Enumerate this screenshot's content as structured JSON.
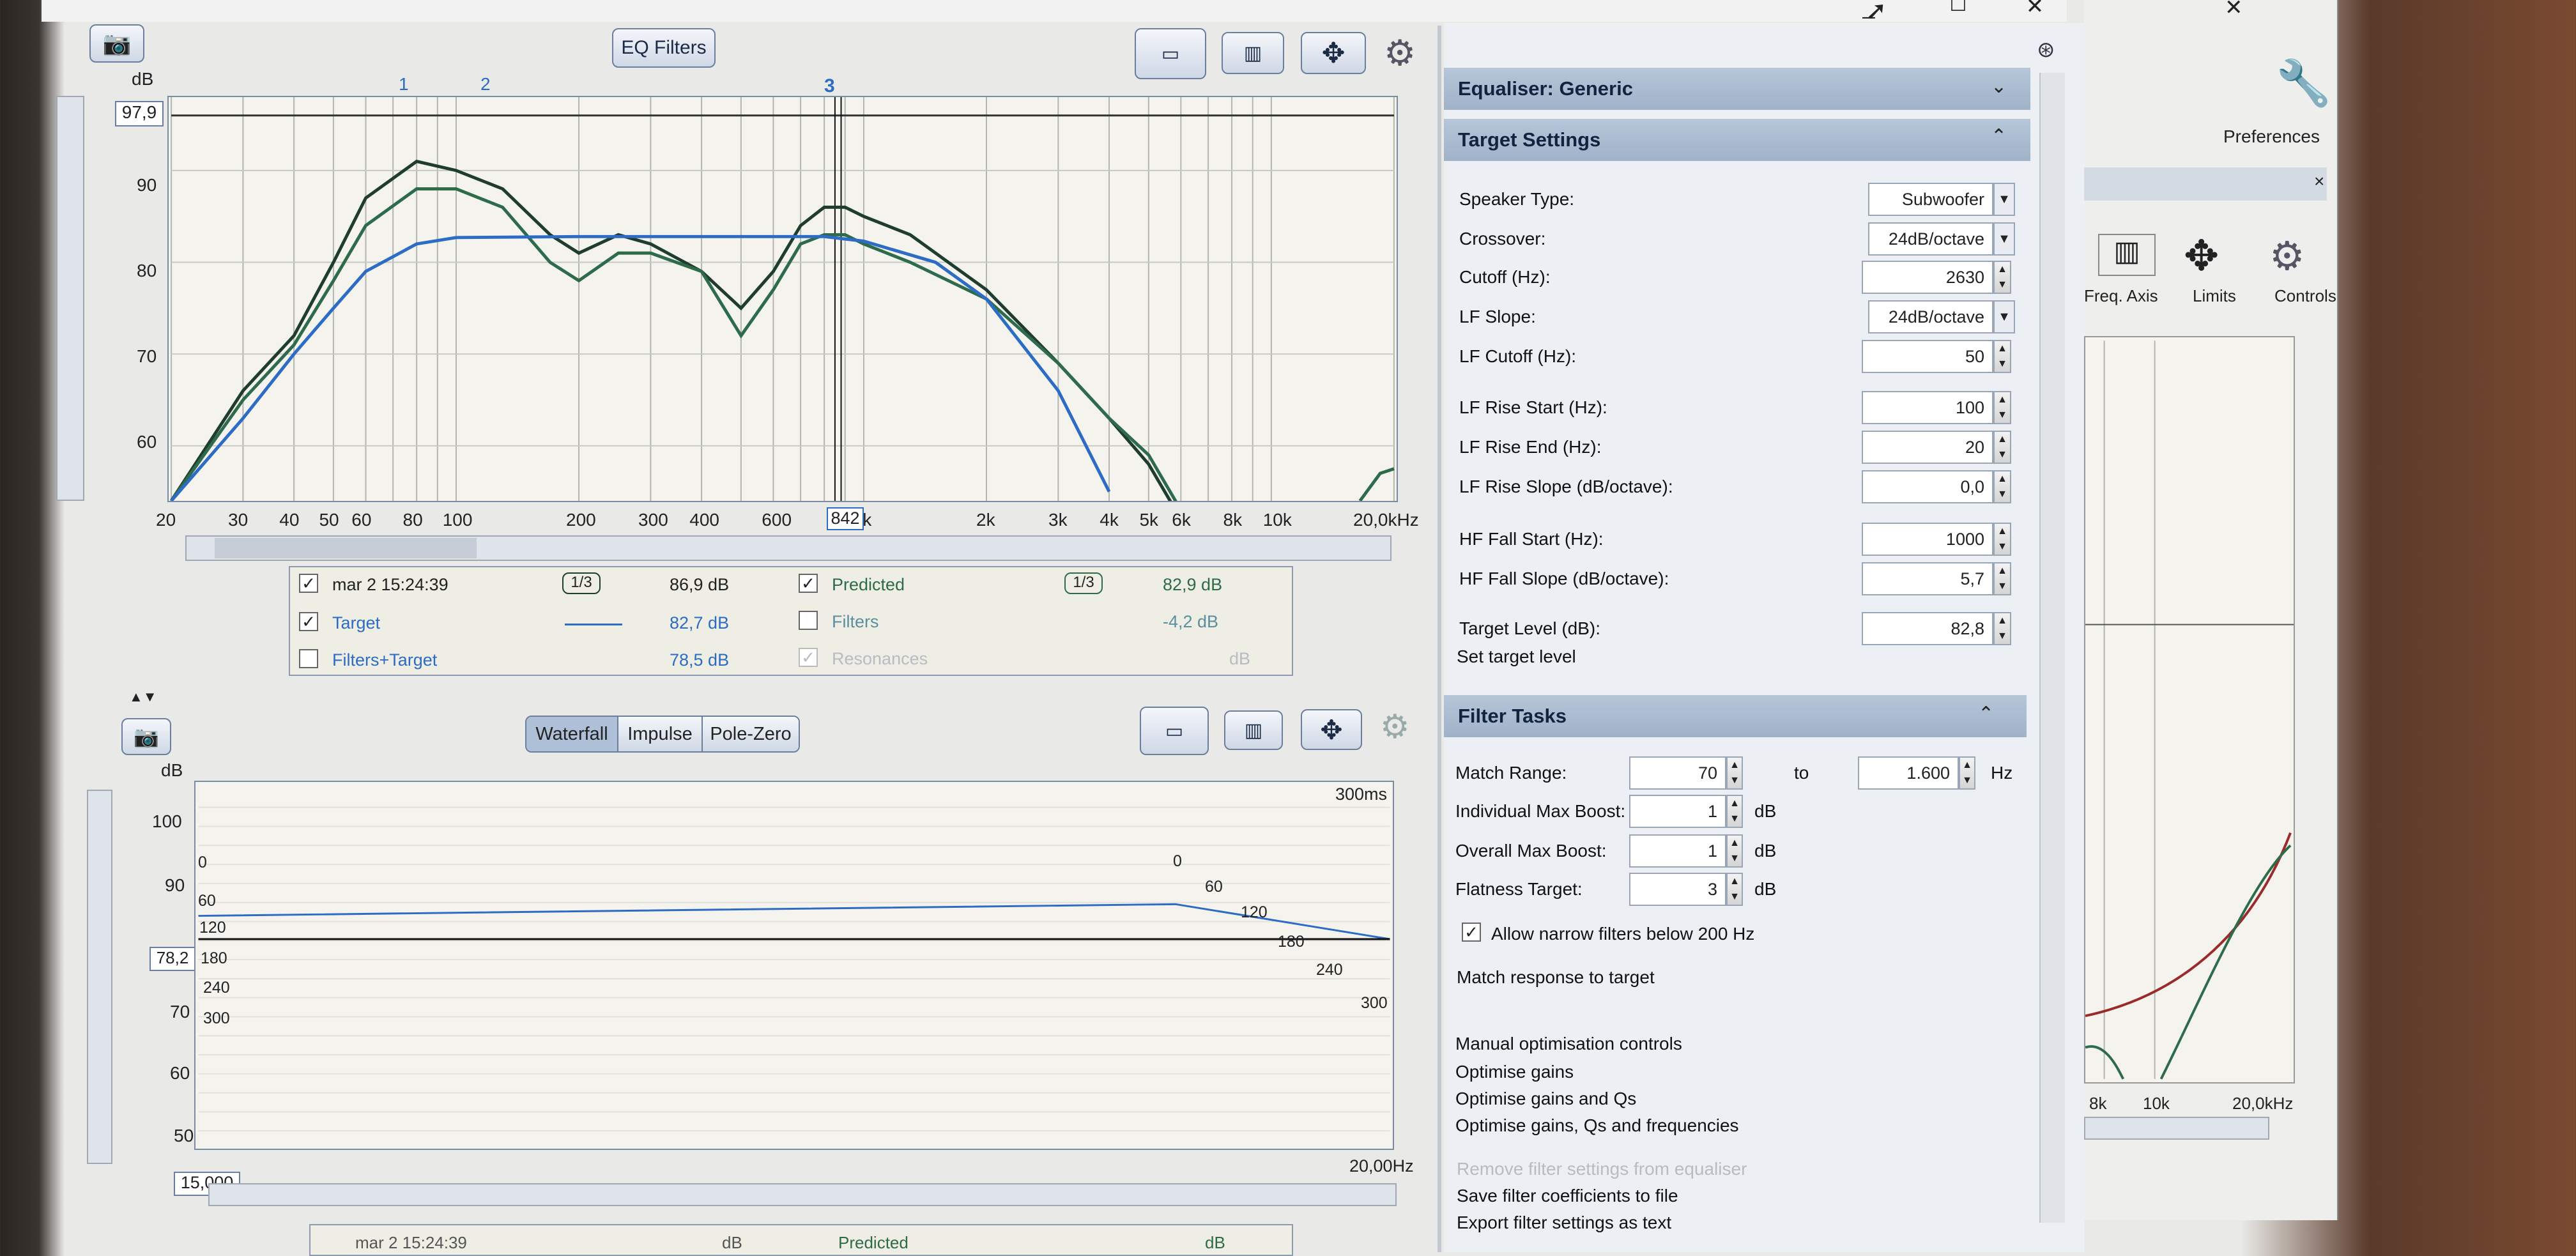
{
  "window": {
    "minimize": "_",
    "maximize": "☐",
    "close": "✕"
  },
  "top_toolbar": {
    "eq_filters": "EQ Filters"
  },
  "top_chart": {
    "ylabel": "dB",
    "y_ticks": [
      "90",
      "80",
      "70",
      "60"
    ],
    "y_max_field": "97,9",
    "x_ticks": [
      "20",
      "30",
      "40",
      "50",
      "60",
      "80",
      "100",
      "200",
      "300",
      "400",
      "600",
      "1k",
      "2k",
      "3k",
      "4k",
      "5k",
      "6k",
      "8k",
      "10k",
      "20,0kHz"
    ],
    "cursor_field": "842",
    "filter_markers": [
      "1",
      "2",
      "3"
    ]
  },
  "chart_data": [
    {
      "type": "line",
      "xlabel": "",
      "ylabel": "dB",
      "x_scale": "log",
      "xlim": [
        20,
        20000
      ],
      "ylim": [
        54,
        98
      ],
      "series": [
        {
          "name": "mar 2 15:24:39",
          "color": "#1f3d2f",
          "x": [
            20,
            30,
            40,
            50,
            60,
            80,
            100,
            130,
            170,
            200,
            250,
            300,
            400,
            500,
            600,
            700,
            800,
            900,
            1000,
            1300,
            2000,
            3000,
            4000,
            5000,
            6000
          ],
          "y": [
            54,
            66,
            72,
            80,
            87,
            91,
            90,
            88,
            83,
            81,
            83,
            82,
            79,
            75,
            79,
            84,
            86,
            86,
            85,
            83,
            77,
            69,
            63,
            58,
            52
          ]
        },
        {
          "name": "Predicted",
          "color": "#2e6b4a",
          "x": [
            20,
            30,
            40,
            50,
            60,
            80,
            100,
            130,
            170,
            200,
            250,
            300,
            400,
            500,
            600,
            700,
            800,
            900,
            1000,
            1300,
            2000,
            3000,
            4000,
            5000,
            6000
          ],
          "y": [
            54,
            65,
            71,
            78,
            84,
            88,
            88,
            86,
            80,
            78,
            81,
            81,
            79,
            72,
            77,
            82,
            83,
            83,
            82,
            80,
            76,
            69,
            63,
            59,
            53
          ]
        },
        {
          "name": "Target",
          "color": "#2c6cc4",
          "x": [
            20,
            30,
            40,
            50,
            60,
            80,
            100,
            200,
            300,
            400,
            600,
            800,
            1000,
            1500,
            2000,
            3000,
            4000
          ],
          "y": [
            54,
            63,
            70,
            75,
            79,
            82,
            82.7,
            82.8,
            82.8,
            82.8,
            82.8,
            82.8,
            82.3,
            80,
            76,
            66,
            55
          ]
        }
      ]
    },
    {
      "type": "line",
      "ylabel": "dB",
      "ylim": [
        45,
        108
      ],
      "series": [
        {
          "name": "blue trace",
          "color": "#2c6cc4",
          "x": [
            0,
            1
          ],
          "y": [
            85,
            87
          ]
        },
        {
          "name": "black trace",
          "color": "#111111",
          "x": [
            0,
            1
          ],
          "y": [
            81,
            81
          ]
        }
      ]
    }
  ],
  "legend": {
    "rows": [
      {
        "name": "mar 2 15:24:39",
        "smoothing": "1/3",
        "value": "86,9 dB",
        "checked": true
      },
      {
        "name": "Target",
        "value": "82,7 dB",
        "checked": true
      },
      {
        "name": "Filters+Target",
        "value": "78,5 dB",
        "checked": false
      },
      {
        "name": "Predicted",
        "smoothing": "1/3",
        "value": "82,9 dB",
        "checked": true
      },
      {
        "name": "Filters",
        "value": "-4,2 dB",
        "checked": false
      },
      {
        "name": "Resonances",
        "value": "dB",
        "checked": true
      }
    ]
  },
  "bottom_toolbar": {
    "tabs": [
      "Waterfall",
      "Impulse",
      "Pole-Zero"
    ]
  },
  "bottom_chart": {
    "ylabel": "dB",
    "y_ticks": [
      "100",
      "90",
      "80",
      "70",
      "60",
      "50"
    ],
    "top_right": "300ms",
    "y_field": "78,2",
    "x_field": "15,000",
    "x_end": "20,00Hz",
    "left_labels": [
      "0",
      "60",
      "120",
      "180",
      "240",
      "300"
    ],
    "right_labels": [
      "0",
      "60",
      "120",
      "180",
      "240",
      "300"
    ]
  },
  "bottom_legend_partial": {
    "name": "mar 2 15:24:39",
    "value": "dB",
    "pred": "Predicted",
    "pval": "dB"
  },
  "panel": {
    "equaliser": "Equaliser: Generic",
    "target_settings": "Target Settings",
    "rows": [
      {
        "label": "Speaker Type:",
        "value": "Subwoofer",
        "kind": "drop"
      },
      {
        "label": "Crossover:",
        "value": "24dB/octave",
        "kind": "drop"
      },
      {
        "label": "Cutoff (Hz):",
        "value": "2630",
        "kind": "spin"
      },
      {
        "label": "LF Slope:",
        "value": "24dB/octave",
        "kind": "drop"
      },
      {
        "label": "LF Cutoff (Hz):",
        "value": "50",
        "kind": "spin"
      },
      {
        "label": "LF Rise Start (Hz):",
        "value": "100",
        "kind": "spin"
      },
      {
        "label": "LF Rise End (Hz):",
        "value": "20",
        "kind": "spin"
      },
      {
        "label": "LF Rise Slope (dB/octave):",
        "value": "0,0",
        "kind": "spin"
      },
      {
        "label": "HF Fall Start (Hz):",
        "value": "1000",
        "kind": "spin"
      },
      {
        "label": "HF Fall Slope (dB/octave):",
        "value": "5,7",
        "kind": "spin"
      },
      {
        "label": "Target Level (dB):",
        "value": "82,8",
        "kind": "spin"
      }
    ],
    "set_target_level": "Set target level",
    "filter_tasks": "Filter Tasks",
    "match_range_label": "Match Range:",
    "match_from": "70",
    "to": "to",
    "match_to": "1.600",
    "hz": "Hz",
    "boost_rows": [
      {
        "label": "Individual Max Boost:",
        "value": "1",
        "unit": "dB"
      },
      {
        "label": "Overall Max Boost:",
        "value": "1",
        "unit": "dB"
      },
      {
        "label": "Flatness Target:",
        "value": "3",
        "unit": "dB"
      }
    ],
    "allow_narrow": "Allow narrow filters below 200 Hz",
    "match_response": "Match response to target",
    "manual": "Manual optimisation controls",
    "opt1": "Optimise gains",
    "opt2": "Optimise gains and Qs",
    "opt3": "Optimise gains, Qs and frequencies",
    "remove": "Remove filter settings from equaliser",
    "save_coeff": "Save filter coefficients to file",
    "export": "Export filter settings as text"
  },
  "back_window": {
    "preferences": "Preferences",
    "tools": [
      "Freq. Axis",
      "Limits",
      "Controls"
    ],
    "x_ticks": [
      "8k",
      "10k",
      "20,0kHz"
    ]
  }
}
